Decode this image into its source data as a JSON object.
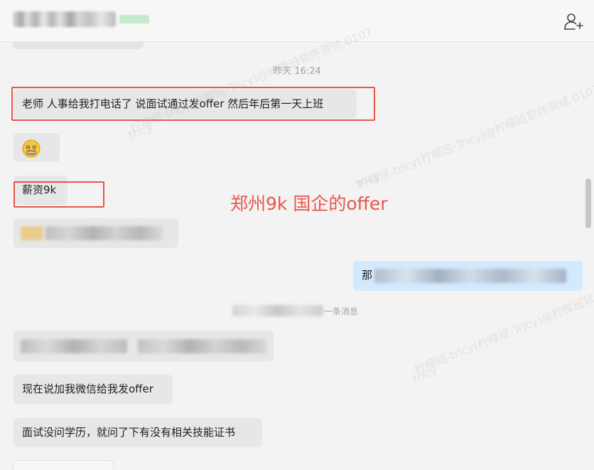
{
  "header": {
    "title_hidden": "",
    "add_member_icon": "person-add-icon"
  },
  "chat": {
    "timestamp": "昨天 16:24",
    "messages": [
      {
        "text": "老师 人事给我打电话了 说面试通过发offer 然后年后第一天上班",
        "side": "left"
      },
      {
        "text": "😬",
        "side": "left"
      },
      {
        "text": "薪资9k",
        "side": "left"
      },
      {
        "text": "",
        "side": "left",
        "blurred": true
      },
      {
        "text": "那",
        "side": "right",
        "blurred_tail": true
      },
      {
        "text": "",
        "side": "left",
        "blurred": true
      },
      {
        "text": "现在说加我微信给我发offer",
        "side": "left"
      },
      {
        "text": "面试没问学历，就问了下有没有相关技能证书",
        "side": "left"
      }
    ],
    "system_text": "一条消息",
    "annotation": "郑州9k 国企的offer"
  },
  "watermarks": [
    "柠檬班-tricy(柠檬班-Tricy)@柠檬班软件测试 0107",
    "tricy",
    "柠檬班-tricy(柠檬班-Tricy)@柠檬班软件测试 0107",
    "tricy",
    "柠檬班-tricy(柠檬班-Tricy)@柠檬班软件测试 0107",
    "tricy"
  ],
  "colors": {
    "accent_red": "#e8564b",
    "bubble_left": "#e7e7e8",
    "bubble_right": "#d3e9fc"
  }
}
